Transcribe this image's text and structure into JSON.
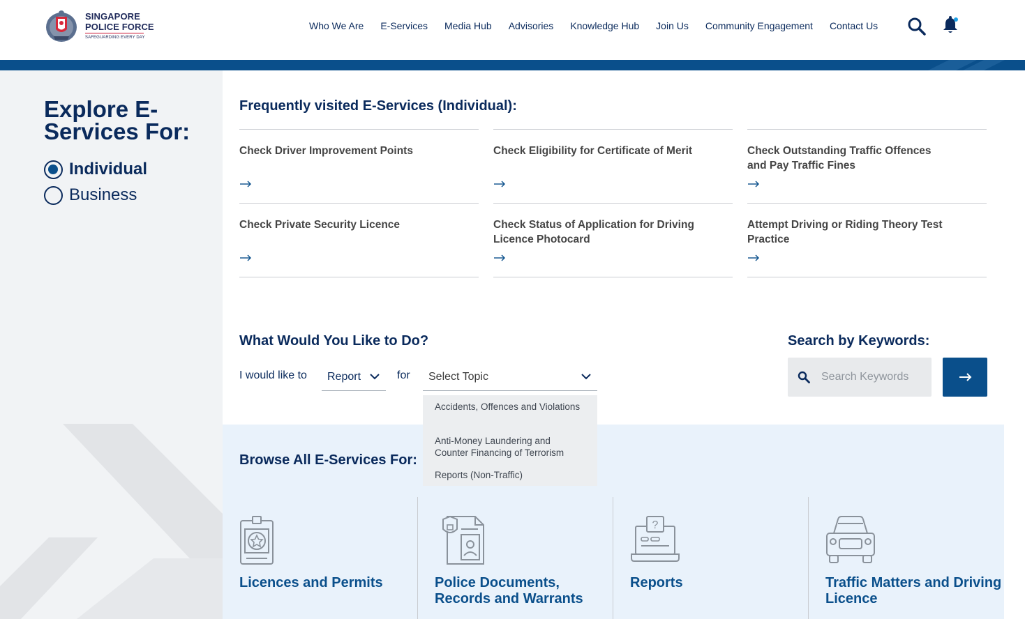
{
  "header": {
    "logo": {
      "line1": "SINGAPORE",
      "line2": "POLICE FORCE",
      "tagline": "SAFEGUARDING EVERY DAY"
    },
    "nav": [
      "Who We Are",
      "E-Services",
      "Media Hub",
      "Advisories",
      "Knowledge Hub",
      "Join Us",
      "Community Engagement",
      "Contact Us"
    ],
    "icons": {
      "search": "search-icon",
      "notifications": "bell-icon"
    }
  },
  "explore": {
    "title": "Explore E-Services For:",
    "options": [
      {
        "label": "Individual",
        "selected": true
      },
      {
        "label": "Business",
        "selected": false
      }
    ]
  },
  "frequent": {
    "title": "Frequently visited E-Services (Individual):",
    "items": [
      "Check Driver Improvement Points",
      "Check Eligibility for Certificate of Merit",
      "Check Outstanding Traffic Offences and Pay Traffic Fines",
      "Check Private Security Licence",
      "Check Status of Application for Driving Licence Photocard",
      "Attempt Driving or Riding Theory Test Practice"
    ]
  },
  "what_to_do": {
    "title": "What Would You Like to Do?",
    "prefix": "I would like to",
    "action_value": "Report",
    "connector": "for",
    "topic_placeholder": "Select Topic",
    "topic_options": [
      "Accidents, Offences and Violations",
      "Anti-Money Laundering and Counter Financing of Terrorism",
      "Reports (Non-Traffic)"
    ]
  },
  "search": {
    "title": "Search by Keywords:",
    "placeholder": "Search Keywords"
  },
  "browse": {
    "title": "Browse All E-Services For:",
    "categories": [
      {
        "label": "Licences and Permits",
        "icon": "licence-badge-icon"
      },
      {
        "label": "Police Documents, Records and Warrants",
        "icon": "police-documents-icon"
      },
      {
        "label": "Reports",
        "icon": "report-laptop-icon"
      },
      {
        "label": "Traffic Matters and Driving Licence",
        "icon": "car-icon"
      }
    ]
  },
  "colors": {
    "navy": "#0a2a5c",
    "accent_blue": "#0a4f8b",
    "panel_grey": "#f1f3f5",
    "browse_bg": "#e9f2fb"
  }
}
